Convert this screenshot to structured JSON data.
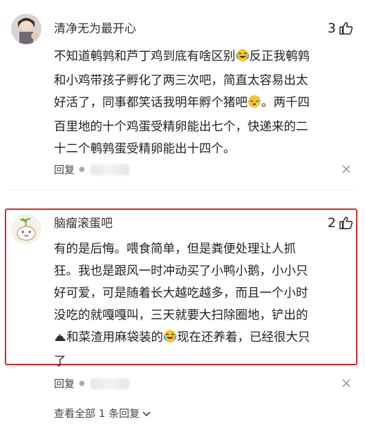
{
  "comments": [
    {
      "username": "清净无为最开心",
      "likes": "3",
      "lines": [
        "不知道鹌鹑和芦丁鸡到底有啥区别",
        "反正我鹌鹑",
        "和小鸡带孩子孵化了两三次吧，简直太容易出太",
        "好活了，同事都笑话我明年孵个猪吧",
        "。两千四",
        "百里地的十个鸡蛋受精卵能出七个，快递来的二",
        "十二个鹌鹑蛋受精卵能出十四个。"
      ],
      "reply_label": "回复"
    },
    {
      "username": "脑瘤滚蛋吧",
      "likes": "2",
      "lines": [
        "有的是后悔。喂食简单，但是粪便处理让人抓",
        "狂。我也是跟风一时冲动买了小鸭小鹅，小小只",
        "好可爱，可是随着长大越吃越多，而且一个小时",
        "没吃的就嘎嘎叫，三天就要大扫除圈地，铲出的",
        "和菜渣用麻袋装的",
        "现在还养着，已经很大只",
        "了"
      ],
      "reply_label": "回复",
      "view_all": "查看全部 1 条回复"
    }
  ],
  "icons": {
    "like": "thumbs-up-icon",
    "close": "close-icon",
    "cry_laugh": "crying-laughing-emoji",
    "sleepy": "sleepy-emoji",
    "poop": "poop-emoji",
    "chevron": "chevron-down-icon"
  },
  "colors": {
    "highlight_border": "#d52a2a"
  }
}
